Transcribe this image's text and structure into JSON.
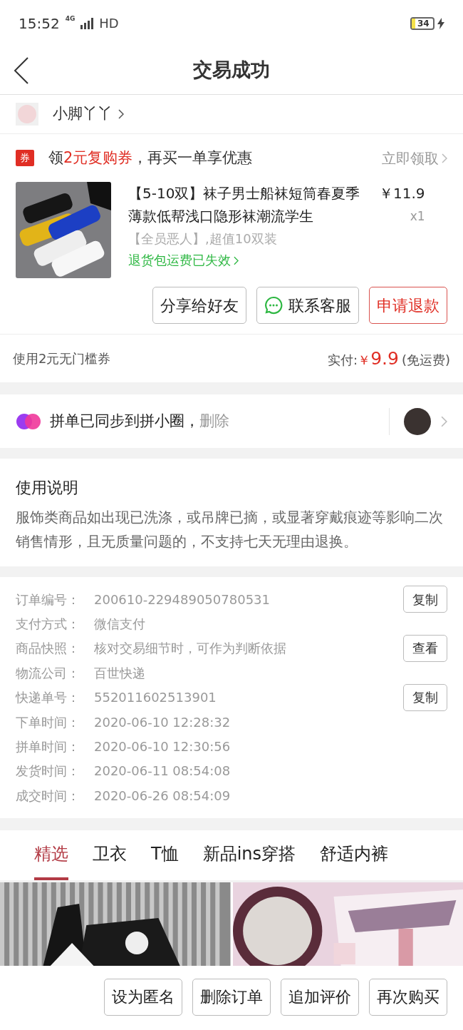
{
  "status_bar": {
    "time": "15:52",
    "network": "4G",
    "hd": "HD",
    "battery": "34",
    "charging": true
  },
  "header": {
    "title": "交易成功"
  },
  "shop": {
    "name": "小脚丫丫"
  },
  "coupon": {
    "badge": "券",
    "text": "领**2元复购券**，再买一单享优惠",
    "action": "立即领取"
  },
  "product": {
    "title": "【5-10双】袜子男士船袜短筒春夏季薄款低帮浅口隐形袜潮流学生",
    "price": "￥11.9",
    "quantity": "x1",
    "spec": "【全员恶人】,超值10双装",
    "return_note": "退货包运费已失效"
  },
  "product_actions": [
    {
      "label": "分享给好友",
      "kind": "plain"
    },
    {
      "label": "联系客服",
      "kind": "chat"
    },
    {
      "label": "申请退款",
      "kind": "primary"
    }
  ],
  "payment": {
    "coupon_used": "使用2元无门槛券",
    "paid_label": "实付:",
    "currency": "￥",
    "amount": "9.9",
    "shipping": "(免运费)"
  },
  "circle": {
    "text": "拼单已同步到拼小圈，",
    "action": "删除"
  },
  "usage": {
    "title": "使用说明",
    "body": "服饰类商品如出现已洗涤，或吊牌已摘，或显著穿戴痕迹等影响二次销售情形，且无质量问题的，不支持七天无理由退换。"
  },
  "order_info": [
    {
      "label": "订单编号：",
      "value": "200610-229489050780531",
      "button": "复制"
    },
    {
      "label": "支付方式：",
      "value": "微信支付"
    },
    {
      "label": "商品快照：",
      "value": "核对交易细节时，可作为判断依据",
      "button": "查看"
    },
    {
      "label": "物流公司：",
      "value": "百世快递"
    },
    {
      "label": "快递单号：",
      "value": "552011602513901",
      "button": "复制"
    },
    {
      "label": "下单时间：",
      "value": "2020-06-10 12:28:32"
    },
    {
      "label": "拼单时间：",
      "value": "2020-06-10 12:30:56"
    },
    {
      "label": "发货时间：",
      "value": "2020-06-11 08:54:08"
    },
    {
      "label": "成交时间：",
      "value": "2020-06-26 08:54:09"
    }
  ],
  "category_tabs": [
    {
      "label": "精选",
      "selected": true
    },
    {
      "label": "卫衣",
      "selected": false
    },
    {
      "label": "T恤",
      "selected": false
    },
    {
      "label": "新品ins穿搭",
      "selected": false
    },
    {
      "label": "舒适内裤",
      "selected": false
    }
  ],
  "recommendations": [
    {
      "kind": "picture"
    },
    {
      "kind": "picture"
    }
  ],
  "bottom_actions": [
    "设为匿名",
    "删除订单",
    "追加评价",
    "再次购买"
  ]
}
